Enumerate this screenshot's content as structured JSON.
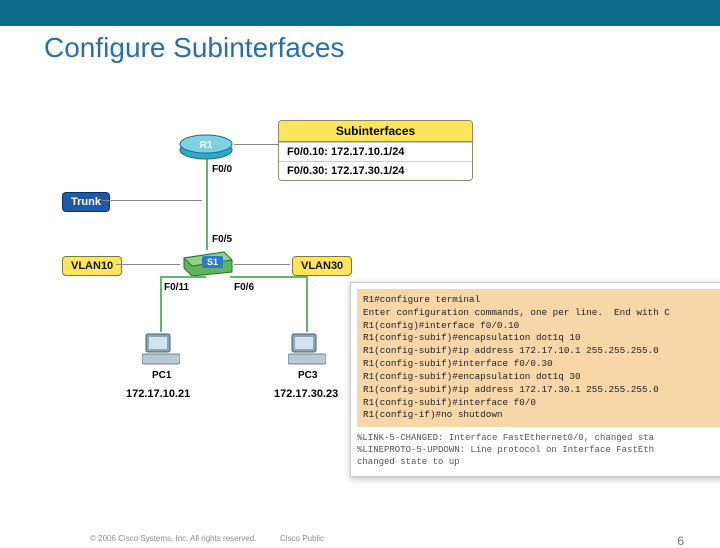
{
  "header": {
    "title": "Configure Subinterfaces"
  },
  "topology": {
    "trunk_label": "Trunk",
    "vlan10_label": "VLAN10",
    "vlan30_label": "VLAN30",
    "router_name": "R1",
    "switch_name": "S1",
    "pc1_name": "PC1",
    "pc3_name": "PC3",
    "port_r1": "F0/0",
    "port_s1_up": "F0/5",
    "port_s1_pc1": "F0/11",
    "port_s1_pc3": "F0/6",
    "pc1_ip": "172.17.10.21",
    "pc3_ip": "172.17.30.23",
    "subif_header": "Subinterfaces",
    "subif_1": "F0/0.10: 172.17.10.1/24",
    "subif_2": "F0/0.30: 172.17.30.1/24"
  },
  "cli": {
    "l01": "R1#configure terminal",
    "l02": "Enter configuration commands, one per line.  End with C",
    "l03": "R1(config)#interface f0/0.10",
    "l04": "R1(config-subif)#encapsulation dot1q 10",
    "l05": "R1(config-subif)#ip address 172.17.10.1 255.255.255.0",
    "l06": "R1(config-subif)#interface f0/0.30",
    "l07": "R1(config-subif)#encapsulation dot1q 30",
    "l08": "R1(config-subif)#ip address 172.17.30.1 255.255.255.0",
    "l09": "R1(config-subif)#interface f0/0",
    "l10": "R1(config-if)#no shutdown",
    "s1": "%LINK-5-CHANGED: Interface FastEthernet0/0, changed sta",
    "s2": "%LINEPROTO-5-UPDOWN: Line protocol on Interface FastEth",
    "s3": "changed state to up"
  },
  "footer": {
    "copyright": "© 2006 Cisco Systems, Inc. All rights reserved.",
    "classification": "Cisco Public",
    "page": "6"
  }
}
